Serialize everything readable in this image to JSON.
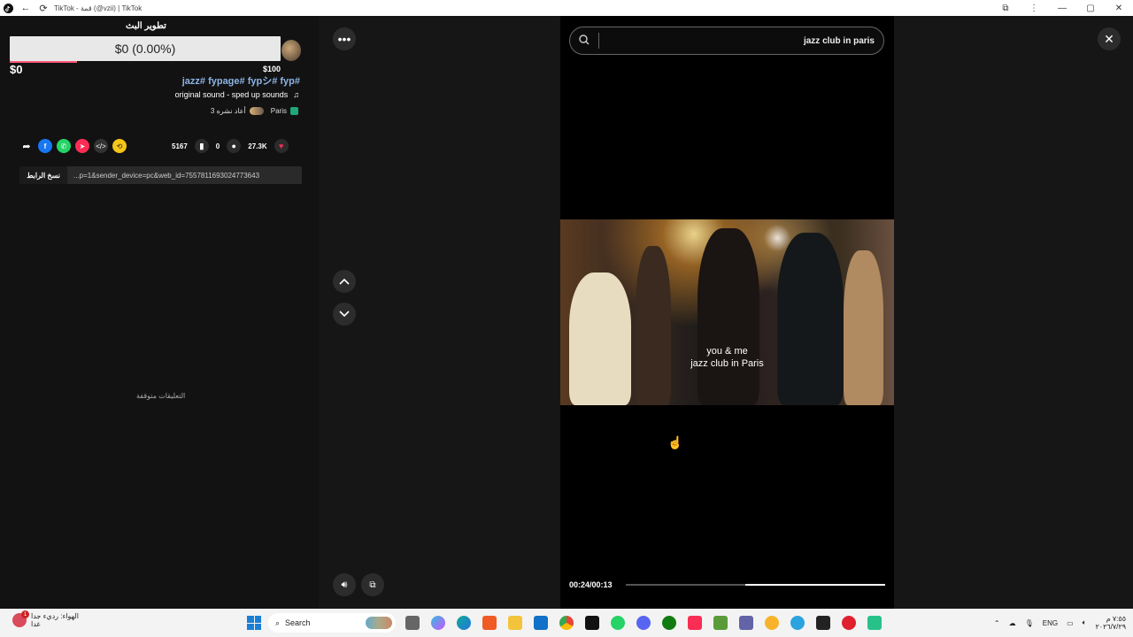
{
  "window": {
    "title": "TikTok - قمة (@vzii) | TikTok",
    "controls": {
      "minimize": "—",
      "maximize": "▢",
      "close": "✕"
    }
  },
  "goal": {
    "title": "تطوير البث",
    "progress_text": "$0 (0.00%)",
    "min_label": "$0",
    "max_label": "$100",
    "progress_fraction": 0.0
  },
  "post": {
    "hashtags": "jazz# fypage# fypシ# fyp#",
    "sound": "original sound - sped up sounds",
    "location": "Paris",
    "reposts": "3 أعاد نشره"
  },
  "stats": {
    "favorites": "5167",
    "comments": "0",
    "likes": "27.3K"
  },
  "link": {
    "copy_label": "نسخ الرابط",
    "url": "...p=1&sender_device=pc&web_id=7557811693024773643"
  },
  "comments_limited": "التعليقات متوقفة",
  "search": {
    "value": "jazz club in paris"
  },
  "video": {
    "caption_line1": "you & me",
    "caption_line2": "jazz club in Paris",
    "time_display": "00:24/00:13",
    "progress_fraction": 0.46
  },
  "taskbar": {
    "weather_line1": "الهواء: رديء جدا",
    "weather_line2": "غدا",
    "weather_badge": "1",
    "search_label": "Search",
    "language": "ENG",
    "time": "٧:٥٥ م",
    "date": "٢٠٢٦/٧/٢٩"
  },
  "colors": {
    "accent_like": "#fe2c55",
    "hashtag": "#8cb4e6",
    "location_badge": "#1fa87a"
  }
}
